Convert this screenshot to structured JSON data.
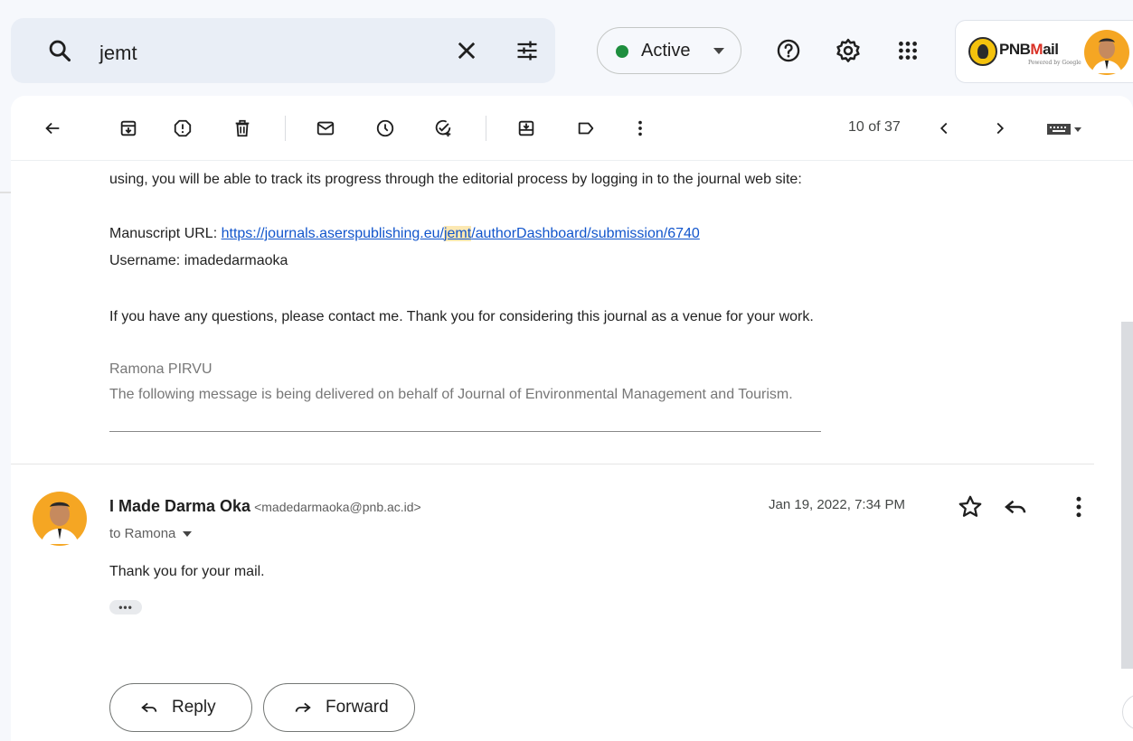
{
  "search": {
    "query": "jemt",
    "icon": "search-icon",
    "clear_icon": "close-icon",
    "options_icon": "tune-icon"
  },
  "status": {
    "label": "Active",
    "color": "#1e8e3e"
  },
  "header_icons": [
    "help-icon",
    "settings-icon",
    "apps-icon"
  ],
  "account": {
    "brand_prefix": "PNB",
    "brand_m": "M",
    "brand_suffix": "ail",
    "powered_by": "Powered by Google"
  },
  "toolbar": {
    "pager": "10 of 37"
  },
  "message": {
    "line1": "using, you will be able to track its progress through the editorial process by logging in to the journal web site:",
    "url_label": "Manuscript URL: ",
    "url_before": "https://journals.aserspublishing.eu/",
    "url_highlight": "jemt",
    "url_after": "/authorDashboard/submission/6740",
    "username": "Username: imadedarmaoka",
    "questions": "If you have any questions, please contact me. Thank you for considering this journal as a venue for your work.",
    "signature_name": "Ramona PIRVU",
    "signature_note": "The following message is being delivered on behalf of Journal of Environmental Management and Tourism."
  },
  "reply_message": {
    "sender_name": "I Made Darma Oka",
    "sender_email": "<madedarmaoka@pnb.ac.id>",
    "to": "to Ramona",
    "date": "Jan 19, 2022, 7:34 PM",
    "body": "Thank you for your mail.",
    "trimmed": "•••"
  },
  "actions": {
    "reply": "Reply",
    "forward": "Forward"
  },
  "colors": {
    "link": "#1155cc",
    "highlight": "#fce8b2",
    "search_bg": "#e9eef6"
  }
}
